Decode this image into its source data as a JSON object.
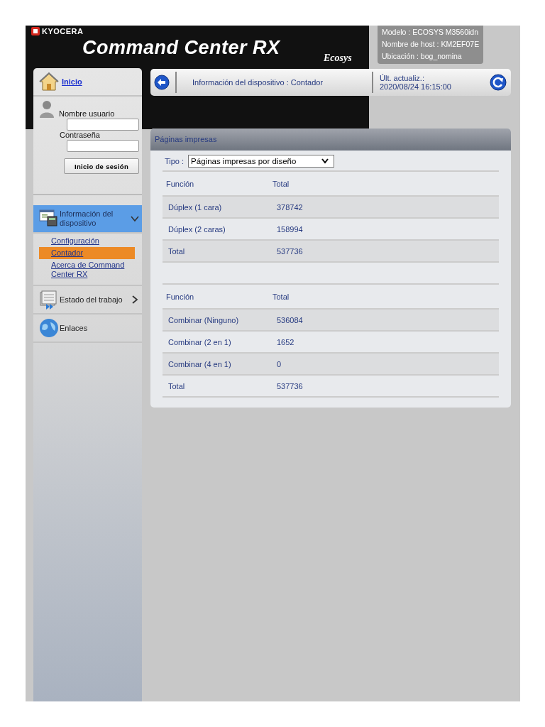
{
  "header": {
    "brand": "KYOCERA",
    "title": "Command Center RX",
    "ecosys_logo": "Ecosys",
    "device_info": [
      "Modelo : ECOSYS M3560idn",
      "Nombre de host : KM2EF07E",
      "Ubicación : bog_nomina"
    ]
  },
  "sidebar": {
    "home": "Inicio",
    "login": {
      "username_label": "Nombre usuario",
      "password_label": "Contraseña",
      "button": "Inicio de sesión"
    },
    "menu": [
      {
        "label": "Información del dispositivo",
        "kind": "device",
        "expanded": true,
        "selected": true,
        "children": [
          {
            "label": "Configuración",
            "selected": false
          },
          {
            "label": "Contador",
            "selected": true
          },
          {
            "label": "Acerca de Command Center RX",
            "selected": false
          }
        ]
      },
      {
        "label": "Estado del trabajo",
        "kind": "job",
        "expanded": false,
        "selected": false
      },
      {
        "label": "Enlaces",
        "kind": "links",
        "selected": false
      }
    ]
  },
  "breadcrumb": {
    "text": "Información del dispositivo : Contador",
    "updated_label": "Últ. actualiz.:",
    "updated_time": "2020/08/24 16:15:00"
  },
  "panel": {
    "title": "Páginas impresas",
    "type_label": "Tipo :",
    "type_value": "Páginas impresas por diseño",
    "tables": [
      {
        "columns": [
          "Función",
          "Total"
        ],
        "rows": [
          [
            "Dúplex (1 cara)",
            "378742"
          ],
          [
            "Dúplex (2 caras)",
            "158994"
          ],
          [
            "Total",
            "537736"
          ]
        ]
      },
      {
        "columns": [
          "Función",
          "Total"
        ],
        "rows": [
          [
            "Combinar (Ninguno)",
            "536084"
          ],
          [
            "Combinar (2 en 1)",
            "1652"
          ],
          [
            "Combinar (4 en 1)",
            "0"
          ],
          [
            "Total",
            "537736"
          ]
        ]
      }
    ]
  }
}
